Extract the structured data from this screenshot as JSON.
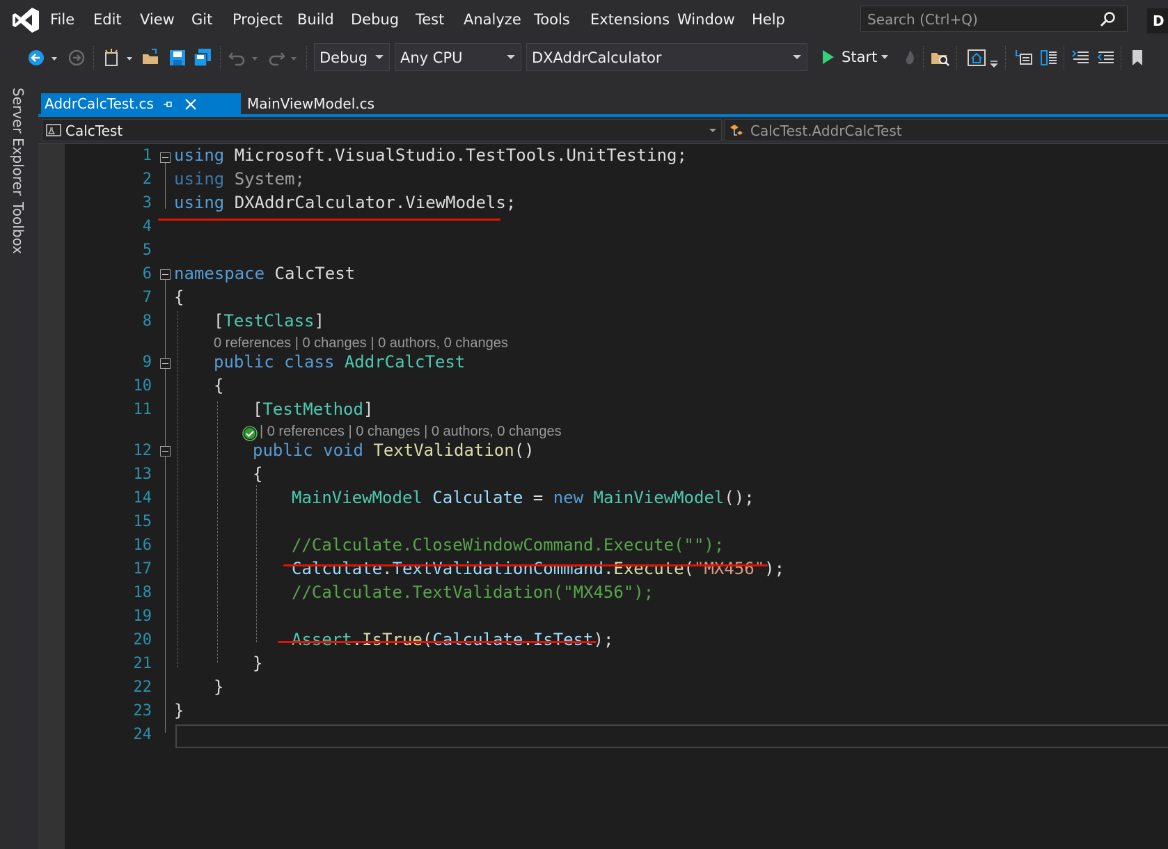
{
  "menubar": {
    "items": [
      "File",
      "Edit",
      "View",
      "Git",
      "Project",
      "Build",
      "Debug",
      "Test",
      "Analyze",
      "Tools",
      "Extensions",
      "Window",
      "Help"
    ],
    "search_placeholder": "Search (Ctrl+Q)",
    "account_initial": "D"
  },
  "toolbar": {
    "configuration": "Debug",
    "platform": "Any CPU",
    "startup_project": "DXAddrCalculator",
    "start_label": "Start"
  },
  "left_rail": {
    "tabs": [
      "Server Explorer",
      "Toolbox"
    ]
  },
  "tabs": [
    {
      "label": "AddrCalcTest.cs",
      "active": true
    },
    {
      "label": "MainViewModel.cs",
      "active": false
    }
  ],
  "navbar": {
    "project": "CalcTest",
    "type": "CalcTest.AddrCalcTest"
  },
  "codelens": {
    "class_info": "0 references | 0 changes | 0 authors, 0 changes",
    "method_info": "| 0 references | 0 changes | 0 authors, 0 changes"
  },
  "code": {
    "line_numbers": [
      "1",
      "2",
      "3",
      "4",
      "5",
      "6",
      "7",
      "8",
      "9",
      "10",
      "11",
      "12",
      "13",
      "14",
      "15",
      "16",
      "17",
      "18",
      "19",
      "20",
      "21",
      "22",
      "23",
      "24"
    ],
    "l1": [
      "using",
      " Microsoft.VisualStudio.TestTools.UnitTesting;"
    ],
    "l2": [
      "using",
      " System;"
    ],
    "l3": [
      "using",
      " DXAddrCalculator.ViewModels;"
    ],
    "l6": [
      "namespace",
      " CalcTest"
    ],
    "l7": "{",
    "l8": [
      "[",
      "TestClass",
      "]"
    ],
    "l9": [
      "public",
      " ",
      "class",
      " ",
      "AddrCalcTest"
    ],
    "l10": "{",
    "l11": [
      "[",
      "TestMethod",
      "]"
    ],
    "l12": [
      "public",
      " ",
      "void",
      " ",
      "TextValidation",
      "()"
    ],
    "l13": "{",
    "l14": [
      "MainViewModel",
      " ",
      "Calculate",
      " = ",
      "new",
      " ",
      "MainViewModel",
      "();"
    ],
    "l16": "//Calculate.CloseWindowCommand.Execute(\"\");",
    "l17": [
      "Calculate",
      ".",
      "TextValidationCommand",
      ".",
      "Execute",
      "(",
      "\"MX456\"",
      ");"
    ],
    "l18": "//Calculate.TextValidation(\"MX456\");",
    "l20": [
      "Assert",
      ".",
      "IsTrue",
      "(",
      "Calculate",
      ".",
      "IsTest",
      ");"
    ],
    "l21": "}",
    "l22": "}",
    "l23": "}"
  },
  "colors": {
    "accent": "#007acc",
    "keyword": "#569cd6",
    "type": "#4ec9b0",
    "comment": "#57a64a",
    "string": "#d69d85",
    "annotation_underline": "#e51400"
  }
}
